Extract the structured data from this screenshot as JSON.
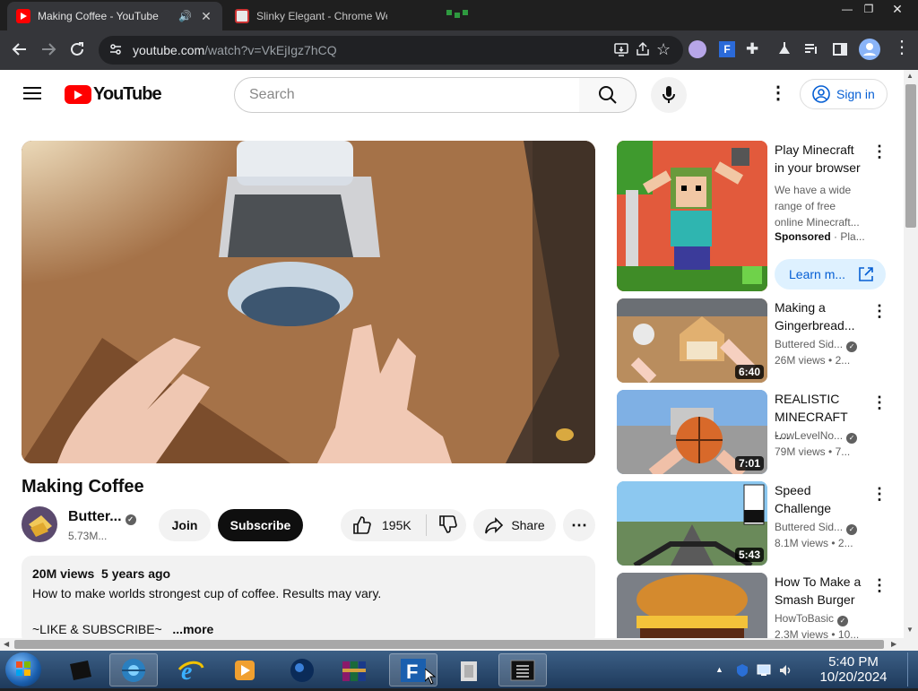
{
  "browser": {
    "tabs": [
      {
        "title": "Making Coffee - YouTube",
        "active": true,
        "audio": true
      },
      {
        "title": "Slinky Elegant - Chrome Web",
        "active": false
      }
    ],
    "address": {
      "host": "youtube.com",
      "path": "/watch?v=VkEjIgz7hCQ"
    },
    "window_controls": [
      "minimize",
      "restore",
      "close"
    ]
  },
  "youtube": {
    "logo_text": "YouTube",
    "search_placeholder": "Search",
    "sign_in": "Sign in",
    "video": {
      "title": "Making Coffee",
      "channel": "Butter...",
      "subscribers": "5.73M...",
      "join": "Join",
      "subscribe": "Subscribe",
      "likes": "195K",
      "share": "Share",
      "views": "20M views",
      "age": "5 years ago",
      "description_line1": "How to make worlds strongest cup of coffee. Results may vary.",
      "description_line2": "~LIKE & SUBSCRIBE~",
      "more": "...more"
    },
    "sidebar": [
      {
        "title_l1": "Play Minecraft",
        "title_l2": "in your browser",
        "desc_l1": "We have a wide",
        "desc_l2": "range of free",
        "desc_l3": "online Minecraft...",
        "sponsored": "Sponsored",
        "sponsor_suffix": "· Pla...",
        "cta": "Learn m..."
      },
      {
        "title_l1": "Making a",
        "title_l2": "Gingerbread...",
        "channel": "Buttered Sid...",
        "views": "26M views",
        "age": "• 2...",
        "duration": "6:40"
      },
      {
        "title_l1": "REALISTIC",
        "title_l2": "MINECRAFT -...",
        "channel": "LowLevelNo...",
        "views": "79M views",
        "age": "• 7...",
        "duration": "7:01"
      },
      {
        "title_l1": "Speed",
        "title_l2": "Challenge",
        "channel": "Buttered Sid...",
        "views": "8.1M views",
        "age": "• 2...",
        "duration": "5:43"
      },
      {
        "title_l1": "How To Make a",
        "title_l2": "Smash Burger",
        "channel": "HowToBasic",
        "views": "2.3M views",
        "age": "• 10..."
      }
    ]
  },
  "taskbar": {
    "time": "5:40 PM",
    "date": "10/20/2024"
  },
  "colors": {
    "yt_red": "#ff0000",
    "link_blue": "#065fd4",
    "chrome_dark": "#35363a"
  }
}
